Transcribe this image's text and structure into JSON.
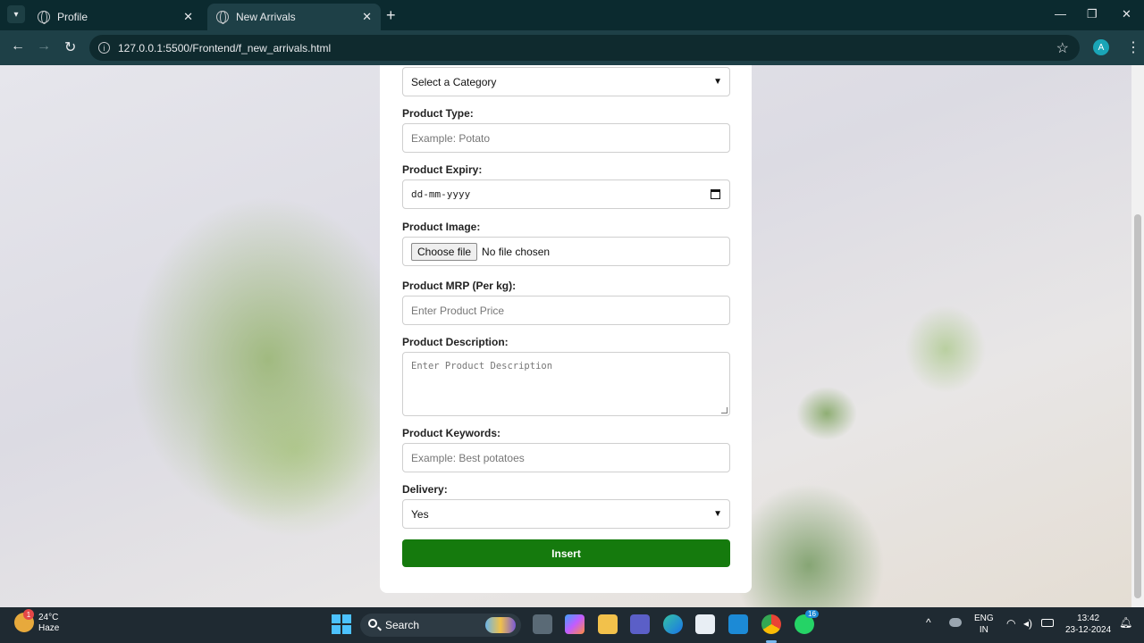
{
  "browser": {
    "tabs": [
      {
        "label": "Profile",
        "active": false
      },
      {
        "label": "New Arrivals",
        "active": true
      }
    ],
    "url": "127.0.0.1:5500/Frontend/f_new_arrivals.html",
    "profile_initial": "A"
  },
  "form": {
    "category_select": "Select a Category",
    "product_type_label": "Product Type:",
    "product_type_placeholder": "Example: Potato",
    "expiry_label": "Product Expiry:",
    "expiry_placeholder": "dd-mm-yyyy",
    "image_label": "Product Image:",
    "choose_file_label": "Choose file",
    "no_file_text": "No file chosen",
    "mrp_label": "Product MRP (Per kg):",
    "mrp_placeholder": "Enter Product Price",
    "description_label": "Product Description:",
    "description_placeholder": "Enter Product Description",
    "keywords_label": "Product Keywords:",
    "keywords_placeholder": "Example: Best potatoes",
    "delivery_label": "Delivery:",
    "delivery_value": "Yes",
    "insert_label": "Insert",
    "accent_color": "#157a0d"
  },
  "taskbar": {
    "weather_temp": "24°C",
    "weather_desc": "Haze",
    "weather_badge": "1",
    "search_label": "Search",
    "whatsapp_badge": "16",
    "language": "ENG",
    "region": "IN",
    "time": "13:42",
    "date": "23-12-2024"
  }
}
